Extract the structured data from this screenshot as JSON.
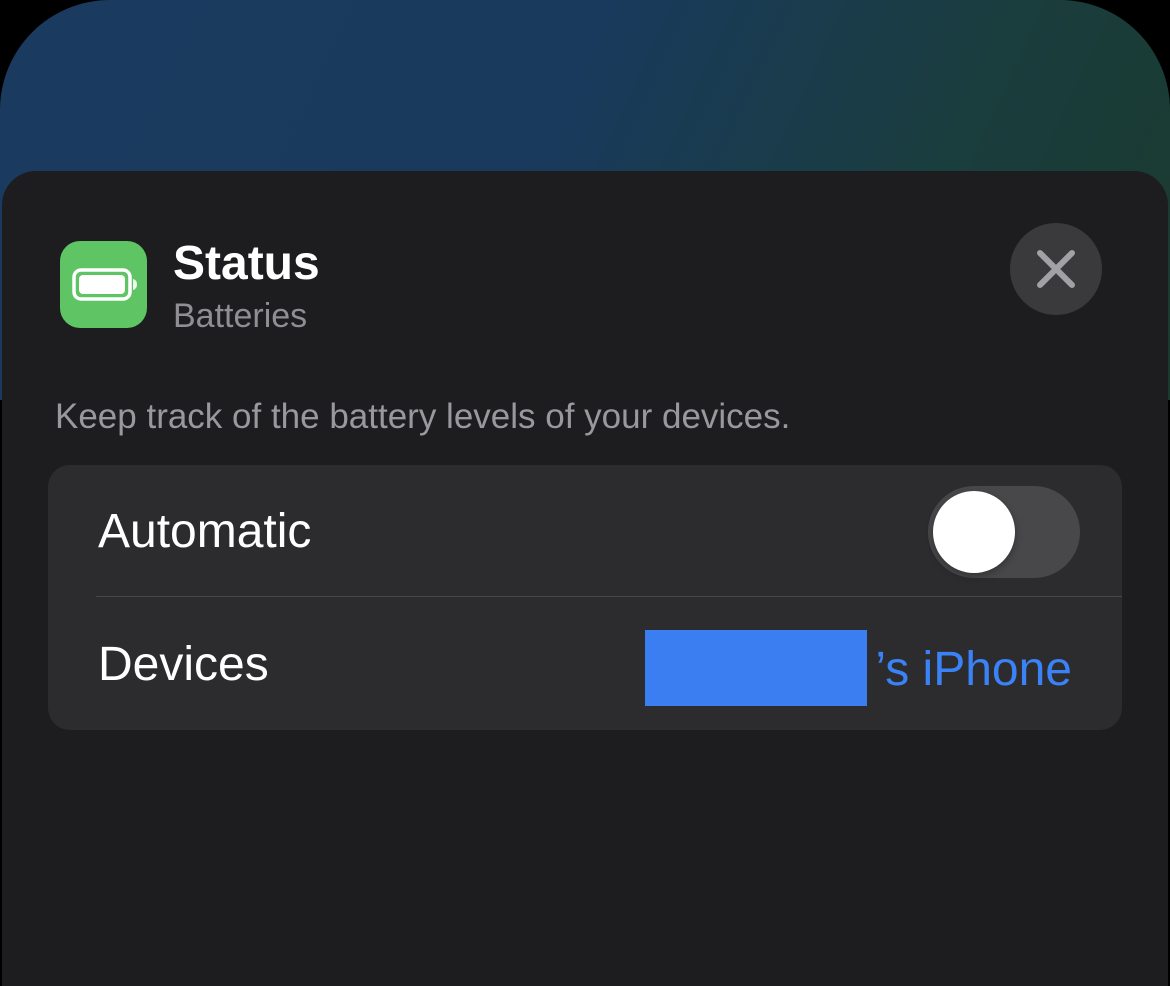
{
  "header": {
    "title": "Status",
    "subtitle": "Batteries",
    "app_icon": "battery-icon",
    "close_icon": "close-icon"
  },
  "description": "Keep track of the battery levels of your devices.",
  "settings": {
    "automatic": {
      "label": "Automatic",
      "toggle_on": false
    },
    "devices": {
      "label": "Devices",
      "value_suffix": "’s iPhone",
      "value_redacted": true
    }
  },
  "colors": {
    "app_icon": "#5fc463",
    "accent": "#3a82f6",
    "sheet": "#1d1d1f"
  }
}
